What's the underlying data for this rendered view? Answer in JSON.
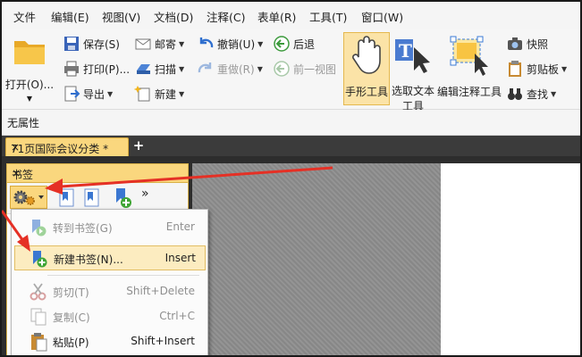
{
  "menu": [
    "文件",
    "编辑(E)",
    "视图(V)",
    "文档(D)",
    "注释(C)",
    "表单(R)",
    "工具(T)",
    "窗口(W)"
  ],
  "ribbon": {
    "open": "打开(O)...",
    "save": "保存(S)",
    "print": "打印(P)...",
    "export": "导出",
    "email": "邮寄",
    "scan": "扫描",
    "new": "新建",
    "undo": "撤销(U)",
    "redo": "重做(R)",
    "back": "后退",
    "prev_view": "前一视图",
    "hand_tool": "手形工具",
    "select_text_tool": "选取文本工具",
    "edit_annotation_tool": "编辑注释工具",
    "snapshot": "快照",
    "clipboard": "剪贴板",
    "find": "查找"
  },
  "properties_bar": "无属性",
  "document_tab": {
    "title": "71页国际会议分类 *",
    "close": "×"
  },
  "bookmark_panel": {
    "title": "书签",
    "close": "×"
  },
  "context_menu": [
    {
      "label": "转到书签(G)",
      "shortcut": "Enter",
      "enabled": false
    },
    {
      "label": "新建书签(N)...",
      "shortcut": "Insert",
      "enabled": true,
      "highlighted": true
    },
    {
      "label": "剪切(T)",
      "shortcut": "Shift+Delete",
      "enabled": false
    },
    {
      "label": "复制(C)",
      "shortcut": "Ctrl+C",
      "enabled": false
    },
    {
      "label": "粘贴(P)",
      "shortcut": "Shift+Insert",
      "enabled": true
    }
  ],
  "colors": {
    "highlight": "#fad77e",
    "annotation_arrow": "#e53025",
    "page_bg": "#ffffff"
  }
}
